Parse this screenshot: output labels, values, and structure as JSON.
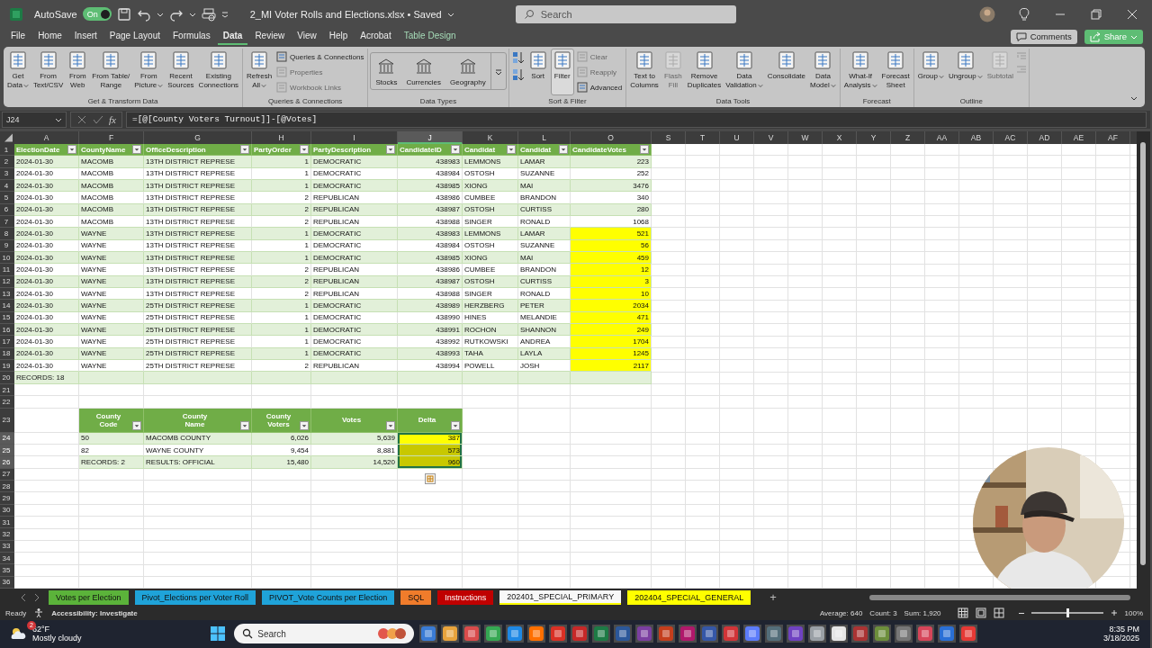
{
  "title_bar": {
    "autosave_label": "AutoSave",
    "autosave": {
      "on": true,
      "label": "On"
    },
    "file_title": "2_MI Voter Rolls and Elections.xlsx • Saved",
    "search_placeholder": "Search"
  },
  "menu_tabs": [
    {
      "label": "File",
      "selected": false,
      "kind": "normal"
    },
    {
      "label": "Home",
      "selected": false,
      "kind": "normal"
    },
    {
      "label": "Insert",
      "selected": false,
      "kind": "normal"
    },
    {
      "label": "Page Layout",
      "selected": false,
      "kind": "normal"
    },
    {
      "label": "Formulas",
      "selected": false,
      "kind": "normal"
    },
    {
      "label": "Data",
      "selected": true,
      "kind": "normal"
    },
    {
      "label": "Review",
      "selected": false,
      "kind": "normal"
    },
    {
      "label": "View",
      "selected": false,
      "kind": "normal"
    },
    {
      "label": "Help",
      "selected": false,
      "kind": "normal"
    },
    {
      "label": "Acrobat",
      "selected": false,
      "kind": "normal"
    },
    {
      "label": "Table Design",
      "selected": false,
      "kind": "contextual"
    }
  ],
  "header_buttons": {
    "comments": "Comments",
    "share": "Share"
  },
  "ribbon": [
    {
      "label": "Get & Transform Data",
      "items": [
        {
          "kind": "large",
          "lines": [
            "Get",
            "Data"
          ],
          "dropdown": true,
          "disabled": false,
          "on": false
        },
        {
          "kind": "large",
          "lines": [
            "From",
            "Text/CSV"
          ],
          "dropdown": false,
          "disabled": false,
          "on": false
        },
        {
          "kind": "large",
          "lines": [
            "From",
            "Web"
          ],
          "dropdown": false,
          "disabled": false,
          "on": false
        },
        {
          "kind": "large",
          "lines": [
            "From Table/",
            "Range"
          ],
          "dropdown": false,
          "disabled": false,
          "on": false
        },
        {
          "kind": "large",
          "lines": [
            "From",
            "Picture"
          ],
          "dropdown": true,
          "disabled": false,
          "on": false
        },
        {
          "kind": "large",
          "lines": [
            "Recent",
            "Sources"
          ],
          "dropdown": false,
          "disabled": false,
          "on": false
        },
        {
          "kind": "large",
          "lines": [
            "Existing",
            "Connections"
          ],
          "dropdown": false,
          "disabled": false,
          "on": false
        }
      ]
    },
    {
      "label": "Queries & Connections",
      "items": [
        {
          "kind": "large",
          "lines": [
            "Refresh",
            "All"
          ],
          "dropdown": true,
          "disabled": false,
          "on": false
        },
        {
          "kind": "stack",
          "entries": [
            {
              "label": "Queries & Connections",
              "disabled": false
            },
            {
              "label": "Properties",
              "disabled": true
            },
            {
              "label": "Workbook Links",
              "disabled": true
            }
          ]
        }
      ]
    },
    {
      "label": "Data Types",
      "items": [
        {
          "kind": "gallery",
          "entries": [
            {
              "label": "Stocks"
            },
            {
              "label": "Currencies"
            },
            {
              "label": "Geography"
            }
          ]
        }
      ]
    },
    {
      "label": "Sort & Filter",
      "items": [
        {
          "kind": "sort_icons"
        },
        {
          "kind": "large",
          "lines": [
            "Sort"
          ],
          "dropdown": false,
          "disabled": false,
          "on": false
        },
        {
          "kind": "large",
          "lines": [
            "Filter"
          ],
          "dropdown": false,
          "disabled": false,
          "on": true
        },
        {
          "kind": "stack",
          "entries": [
            {
              "label": "Clear",
              "disabled": true
            },
            {
              "label": "Reapply",
              "disabled": true
            },
            {
              "label": "Advanced",
              "disabled": false
            }
          ]
        }
      ]
    },
    {
      "label": "Data Tools",
      "items": [
        {
          "kind": "large",
          "lines": [
            "Text to",
            "Columns"
          ],
          "dropdown": false,
          "disabled": false,
          "on": false
        },
        {
          "kind": "large",
          "lines": [
            "Flash",
            "Fill"
          ],
          "dropdown": false,
          "disabled": true,
          "on": false
        },
        {
          "kind": "large",
          "lines": [
            "Remove",
            "Duplicates"
          ],
          "dropdown": false,
          "disabled": false,
          "on": false
        },
        {
          "kind": "large",
          "lines": [
            "Data",
            "Validation"
          ],
          "dropdown": true,
          "disabled": false,
          "on": false
        },
        {
          "kind": "large",
          "lines": [
            "Consolidate"
          ],
          "dropdown": false,
          "disabled": false,
          "on": false
        },
        {
          "kind": "large",
          "lines": [
            "Data",
            "Model"
          ],
          "dropdown": true,
          "disabled": false,
          "on": false
        }
      ]
    },
    {
      "label": "Forecast",
      "items": [
        {
          "kind": "large",
          "lines": [
            "What-If",
            "Analysis"
          ],
          "dropdown": true,
          "disabled": false,
          "on": false
        },
        {
          "kind": "large",
          "lines": [
            "Forecast",
            "Sheet"
          ],
          "dropdown": false,
          "disabled": false,
          "on": false
        }
      ]
    },
    {
      "label": "Outline",
      "items": [
        {
          "kind": "large",
          "lines": [
            "Group"
          ],
          "dropdown": true,
          "disabled": false,
          "on": false
        },
        {
          "kind": "large",
          "lines": [
            "Ungroup"
          ],
          "dropdown": true,
          "disabled": false,
          "on": false
        },
        {
          "kind": "large",
          "lines": [
            "Subtotal"
          ],
          "dropdown": false,
          "disabled": true,
          "on": false
        },
        {
          "kind": "outline_icons"
        }
      ]
    }
  ],
  "formula_bar": {
    "name_box": "J24",
    "fx": "fx",
    "formula": "=[@[County Voters Turnout]]-[@Votes]"
  },
  "columns": [
    {
      "label": "A",
      "selected": false
    },
    {
      "label": "F",
      "selected": false
    },
    {
      "label": "G",
      "selected": false
    },
    {
      "label": "H",
      "selected": false
    },
    {
      "label": "I",
      "selected": false
    },
    {
      "label": "J",
      "selected": true
    },
    {
      "label": "K",
      "selected": false
    },
    {
      "label": "L",
      "selected": false
    },
    {
      "label": "O",
      "selected": false
    },
    {
      "label": "S",
      "selected": false
    },
    {
      "label": "T",
      "selected": false
    },
    {
      "label": "U",
      "selected": false
    },
    {
      "label": "V",
      "selected": false
    },
    {
      "label": "W",
      "selected": false
    },
    {
      "label": "X",
      "selected": false
    },
    {
      "label": "Y",
      "selected": false
    },
    {
      "label": "Z",
      "selected": false
    },
    {
      "label": "AA",
      "selected": false
    },
    {
      "label": "AB",
      "selected": false
    },
    {
      "label": "AC",
      "selected": false
    },
    {
      "label": "AD",
      "selected": false
    },
    {
      "label": "AE",
      "selected": false
    },
    {
      "label": "AF",
      "selected": false
    }
  ],
  "row_numbers": [
    {
      "label": "1",
      "selected": false
    },
    {
      "label": "2",
      "selected": false
    },
    {
      "label": "3",
      "selected": false
    },
    {
      "label": "4",
      "selected": false
    },
    {
      "label": "5",
      "selected": false
    },
    {
      "label": "6",
      "selected": false
    },
    {
      "label": "7",
      "selected": false
    },
    {
      "label": "8",
      "selected": false
    },
    {
      "label": "9",
      "selected": false
    },
    {
      "label": "10",
      "selected": false
    },
    {
      "label": "11",
      "selected": false
    },
    {
      "label": "12",
      "selected": false
    },
    {
      "label": "13",
      "selected": false
    },
    {
      "label": "14",
      "selected": false
    },
    {
      "label": "15",
      "selected": false
    },
    {
      "label": "16",
      "selected": false
    },
    {
      "label": "17",
      "selected": false
    },
    {
      "label": "18",
      "selected": false
    },
    {
      "label": "19",
      "selected": false
    },
    {
      "label": "20",
      "selected": false
    },
    {
      "label": "21",
      "selected": false
    },
    {
      "label": "22",
      "selected": false
    },
    {
      "label": "23",
      "selected": false
    },
    {
      "label": "24",
      "selected": true
    },
    {
      "label": "25",
      "selected": true
    },
    {
      "label": "26",
      "selected": true
    },
    {
      "label": "27",
      "selected": false
    },
    {
      "label": "28",
      "selected": false
    },
    {
      "label": "29",
      "selected": false
    },
    {
      "label": "30",
      "selected": false
    },
    {
      "label": "31",
      "selected": false
    },
    {
      "label": "32",
      "selected": false
    },
    {
      "label": "33",
      "selected": false
    },
    {
      "label": "34",
      "selected": false
    },
    {
      "label": "35",
      "selected": false
    },
    {
      "label": "36",
      "selected": false
    }
  ],
  "table1": {
    "columns": [
      {
        "label": "ElectionDate",
        "kind": "text"
      },
      {
        "label": "CountyName",
        "kind": "text"
      },
      {
        "label": "OfficeDescription",
        "kind": "text"
      },
      {
        "label": "PartyOrder",
        "kind": "number"
      },
      {
        "label": "PartyDescription",
        "kind": "text"
      },
      {
        "label": "CandidateID",
        "kind": "number"
      },
      {
        "label": "Candidat",
        "kind": "text"
      },
      {
        "label": "Candidat",
        "kind": "text"
      },
      {
        "label": "CandidateVotes",
        "kind": "number"
      }
    ],
    "rows": [
      {
        "cells": [
          "2024-01-30",
          "MACOMB",
          "13TH DISTRICT REPRESE",
          "1",
          "DEMOCRATIC",
          "438983",
          "LEMMONS",
          "LAMAR",
          "223"
        ],
        "highlighted": false
      },
      {
        "cells": [
          "2024-01-30",
          "MACOMB",
          "13TH DISTRICT REPRESE",
          "1",
          "DEMOCRATIC",
          "438984",
          "OSTOSH",
          "SUZANNE",
          "252"
        ],
        "highlighted": false
      },
      {
        "cells": [
          "2024-01-30",
          "MACOMB",
          "13TH DISTRICT REPRESE",
          "1",
          "DEMOCRATIC",
          "438985",
          "XIONG",
          "MAI",
          "3476"
        ],
        "highlighted": false
      },
      {
        "cells": [
          "2024-01-30",
          "MACOMB",
          "13TH DISTRICT REPRESE",
          "2",
          "REPUBLICAN",
          "438986",
          "CUMBEE",
          "BRANDON",
          "340"
        ],
        "highlighted": false
      },
      {
        "cells": [
          "2024-01-30",
          "MACOMB",
          "13TH DISTRICT REPRESE",
          "2",
          "REPUBLICAN",
          "438987",
          "OSTOSH",
          "CURTISS",
          "280"
        ],
        "highlighted": false
      },
      {
        "cells": [
          "2024-01-30",
          "MACOMB",
          "13TH DISTRICT REPRESE",
          "2",
          "REPUBLICAN",
          "438988",
          "SINGER",
          "RONALD",
          "1068"
        ],
        "highlighted": false
      },
      {
        "cells": [
          "2024-01-30",
          "WAYNE",
          "13TH DISTRICT REPRESE",
          "1",
          "DEMOCRATIC",
          "438983",
          "LEMMONS",
          "LAMAR",
          "521"
        ],
        "highlighted": true
      },
      {
        "cells": [
          "2024-01-30",
          "WAYNE",
          "13TH DISTRICT REPRESE",
          "1",
          "DEMOCRATIC",
          "438984",
          "OSTOSH",
          "SUZANNE",
          "56"
        ],
        "highlighted": true
      },
      {
        "cells": [
          "2024-01-30",
          "WAYNE",
          "13TH DISTRICT REPRESE",
          "1",
          "DEMOCRATIC",
          "438985",
          "XIONG",
          "MAI",
          "459"
        ],
        "highlighted": true
      },
      {
        "cells": [
          "2024-01-30",
          "WAYNE",
          "13TH DISTRICT REPRESE",
          "2",
          "REPUBLICAN",
          "438986",
          "CUMBEE",
          "BRANDON",
          "12"
        ],
        "highlighted": true
      },
      {
        "cells": [
          "2024-01-30",
          "WAYNE",
          "13TH DISTRICT REPRESE",
          "2",
          "REPUBLICAN",
          "438987",
          "OSTOSH",
          "CURTISS",
          "3"
        ],
        "highlighted": true
      },
      {
        "cells": [
          "2024-01-30",
          "WAYNE",
          "13TH DISTRICT REPRESE",
          "2",
          "REPUBLICAN",
          "438988",
          "SINGER",
          "RONALD",
          "10"
        ],
        "highlighted": true
      },
      {
        "cells": [
          "2024-01-30",
          "WAYNE",
          "25TH DISTRICT REPRESE",
          "1",
          "DEMOCRATIC",
          "438989",
          "HERZBERG",
          "PETER",
          "2034"
        ],
        "highlighted": true
      },
      {
        "cells": [
          "2024-01-30",
          "WAYNE",
          "25TH DISTRICT REPRESE",
          "1",
          "DEMOCRATIC",
          "438990",
          "HINES",
          "MELANDIE",
          "471"
        ],
        "highlighted": true
      },
      {
        "cells": [
          "2024-01-30",
          "WAYNE",
          "25TH DISTRICT REPRESE",
          "1",
          "DEMOCRATIC",
          "438991",
          "ROCHON",
          "SHANNON",
          "249"
        ],
        "highlighted": true
      },
      {
        "cells": [
          "2024-01-30",
          "WAYNE",
          "25TH DISTRICT REPRESE",
          "1",
          "DEMOCRATIC",
          "438992",
          "RUTKOWSKI",
          "ANDREA",
          "1704"
        ],
        "highlighted": true
      },
      {
        "cells": [
          "2024-01-30",
          "WAYNE",
          "25TH DISTRICT REPRESE",
          "1",
          "DEMOCRATIC",
          "438993",
          "TAHA",
          "LAYLA",
          "1245"
        ],
        "highlighted": true
      },
      {
        "cells": [
          "2024-01-30",
          "WAYNE",
          "25TH DISTRICT REPRESE",
          "2",
          "REPUBLICAN",
          "438994",
          "POWELL",
          "JOSH",
          "2117"
        ],
        "highlighted": true
      }
    ],
    "total": "RECORDS: 18"
  },
  "table2": {
    "columns": [
      {
        "label": "County Code",
        "kind": "text"
      },
      {
        "label": "County Name",
        "kind": "text"
      },
      {
        "label": "County Voters",
        "kind": "number"
      },
      {
        "label": "Votes",
        "kind": "number"
      },
      {
        "label": "Delta",
        "kind": "number"
      }
    ],
    "rows": [
      {
        "cells": [
          "50",
          "MACOMB COUNTY",
          "6,026",
          "5,639",
          "387"
        ],
        "highlighted": true,
        "selected": true,
        "active": true
      },
      {
        "cells": [
          "82",
          "WAYNE COUNTY",
          "9,454",
          "8,881",
          "573"
        ],
        "highlighted": true,
        "selected": true,
        "active": false
      },
      {
        "cells": [
          "RECORDS: 2",
          "RESULTS: OFFICIAL",
          "15,480",
          "14,520",
          "960"
        ],
        "highlighted": true,
        "selected": true,
        "active": false
      }
    ]
  },
  "sheet_tabs": [
    {
      "label": "Votes per Election",
      "color": "#5bb33a",
      "selected": false
    },
    {
      "label": "Pivot_Elections per Voter Roll",
      "color": "#1fa3d9",
      "selected": false
    },
    {
      "label": "PIVOT_Vote Counts per Election",
      "color": "#1fa3d9",
      "selected": false
    },
    {
      "label": "SQL",
      "color": "#f07c2b",
      "selected": false
    },
    {
      "label": "Instructions",
      "color": "#c00000",
      "selected": false
    },
    {
      "label": "202401_SPECIAL_PRIMARY",
      "color": "#ffff00",
      "selected": true
    },
    {
      "label": "202404_SPECIAL_GENERAL",
      "color": "#ffff00",
      "selected": false
    }
  ],
  "add_sheet": "+",
  "status_bar": {
    "ready": "Ready",
    "accessibility": "Accessibility: Investigate",
    "average": "Average: 640",
    "count": "Count: 3",
    "sum": "Sum: 1,920",
    "zoom": "100%",
    "level": 0.5
  },
  "taskbar": {
    "weather_badge": "2",
    "temperature": "62°F",
    "condition": "Mostly cloudy",
    "search_placeholder": "Search",
    "time": "8:35 PM",
    "date": "3/18/2025"
  }
}
